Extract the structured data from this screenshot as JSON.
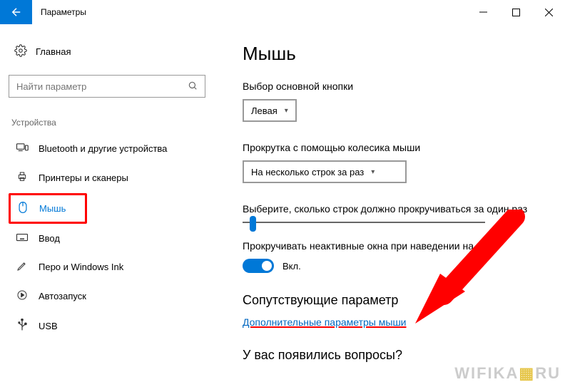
{
  "titlebar": {
    "title": "Параметры"
  },
  "sidebar": {
    "home": "Главная",
    "search_placeholder": "Найти параметр",
    "category": "Устройства",
    "items": [
      {
        "label": "Bluetooth и другие устройства"
      },
      {
        "label": "Принтеры и сканеры"
      },
      {
        "label": "Мышь"
      },
      {
        "label": "Ввод"
      },
      {
        "label": "Перо и Windows Ink"
      },
      {
        "label": "Автозапуск"
      },
      {
        "label": "USB"
      }
    ]
  },
  "main": {
    "title": "Мышь",
    "primary_button": {
      "label": "Выбор основной кнопки",
      "value": "Левая"
    },
    "scroll_mode": {
      "label": "Прокрутка с помощью колесика мыши",
      "value": "На несколько строк за раз"
    },
    "scroll_lines": {
      "label": "Выберите, сколько строк должно прокручиваться за один раз"
    },
    "inactive_hover": {
      "label": "Прокручивать неактивные окна при наведении на них",
      "state": "Вкл."
    },
    "related": {
      "heading": "Сопутствующие параметр",
      "link": "Дополнительные параметры мыши"
    },
    "questions": "У вас появились вопросы?"
  },
  "watermark": {
    "part1": "WIFIKA",
    "part2": "RU"
  }
}
